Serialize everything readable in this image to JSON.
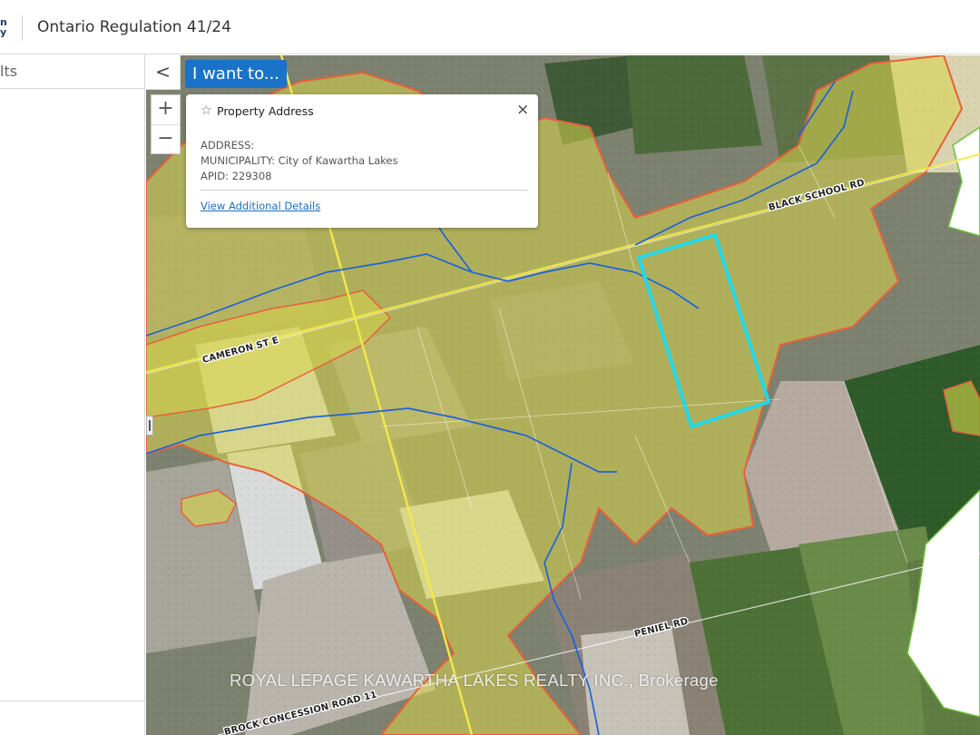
{
  "header": {
    "logo_fragment": "n\ny",
    "title": "Ontario Regulation 41/24"
  },
  "sidebar": {
    "title_fragment": "lts",
    "collapse_icon": "chevron-left-icon",
    "collapse_label": "<"
  },
  "map": {
    "i_want_to_label": "I want to...",
    "zoom_in_label": "+",
    "zoom_out_label": "−",
    "road_labels": {
      "black_school": "BLACK SCHOOL RD",
      "cameron": "CAMERON ST E",
      "peniel": "PENIEL RD",
      "brock": "BROCK CONCESSION ROAD 11"
    },
    "watermark": "ROYAL LEPAGE KAWARTHA LAKES REALTY INC., Brokerage",
    "colors": {
      "regulated_area": "#d8d64a",
      "regulated_outline": "#e8603a",
      "parcel_highlight": "#23d7e6",
      "watercourse": "#1f63d8",
      "road": "#f2e94a"
    }
  },
  "popup": {
    "star_icon": "star-outline-icon",
    "title": "Property Address",
    "close_label": "×",
    "address_line": "ADDRESS:",
    "municipality_line": "MUNICIPALITY: City of Kawartha Lakes",
    "apid_line": "APID: 229308",
    "details_link": "View Additional Details"
  }
}
